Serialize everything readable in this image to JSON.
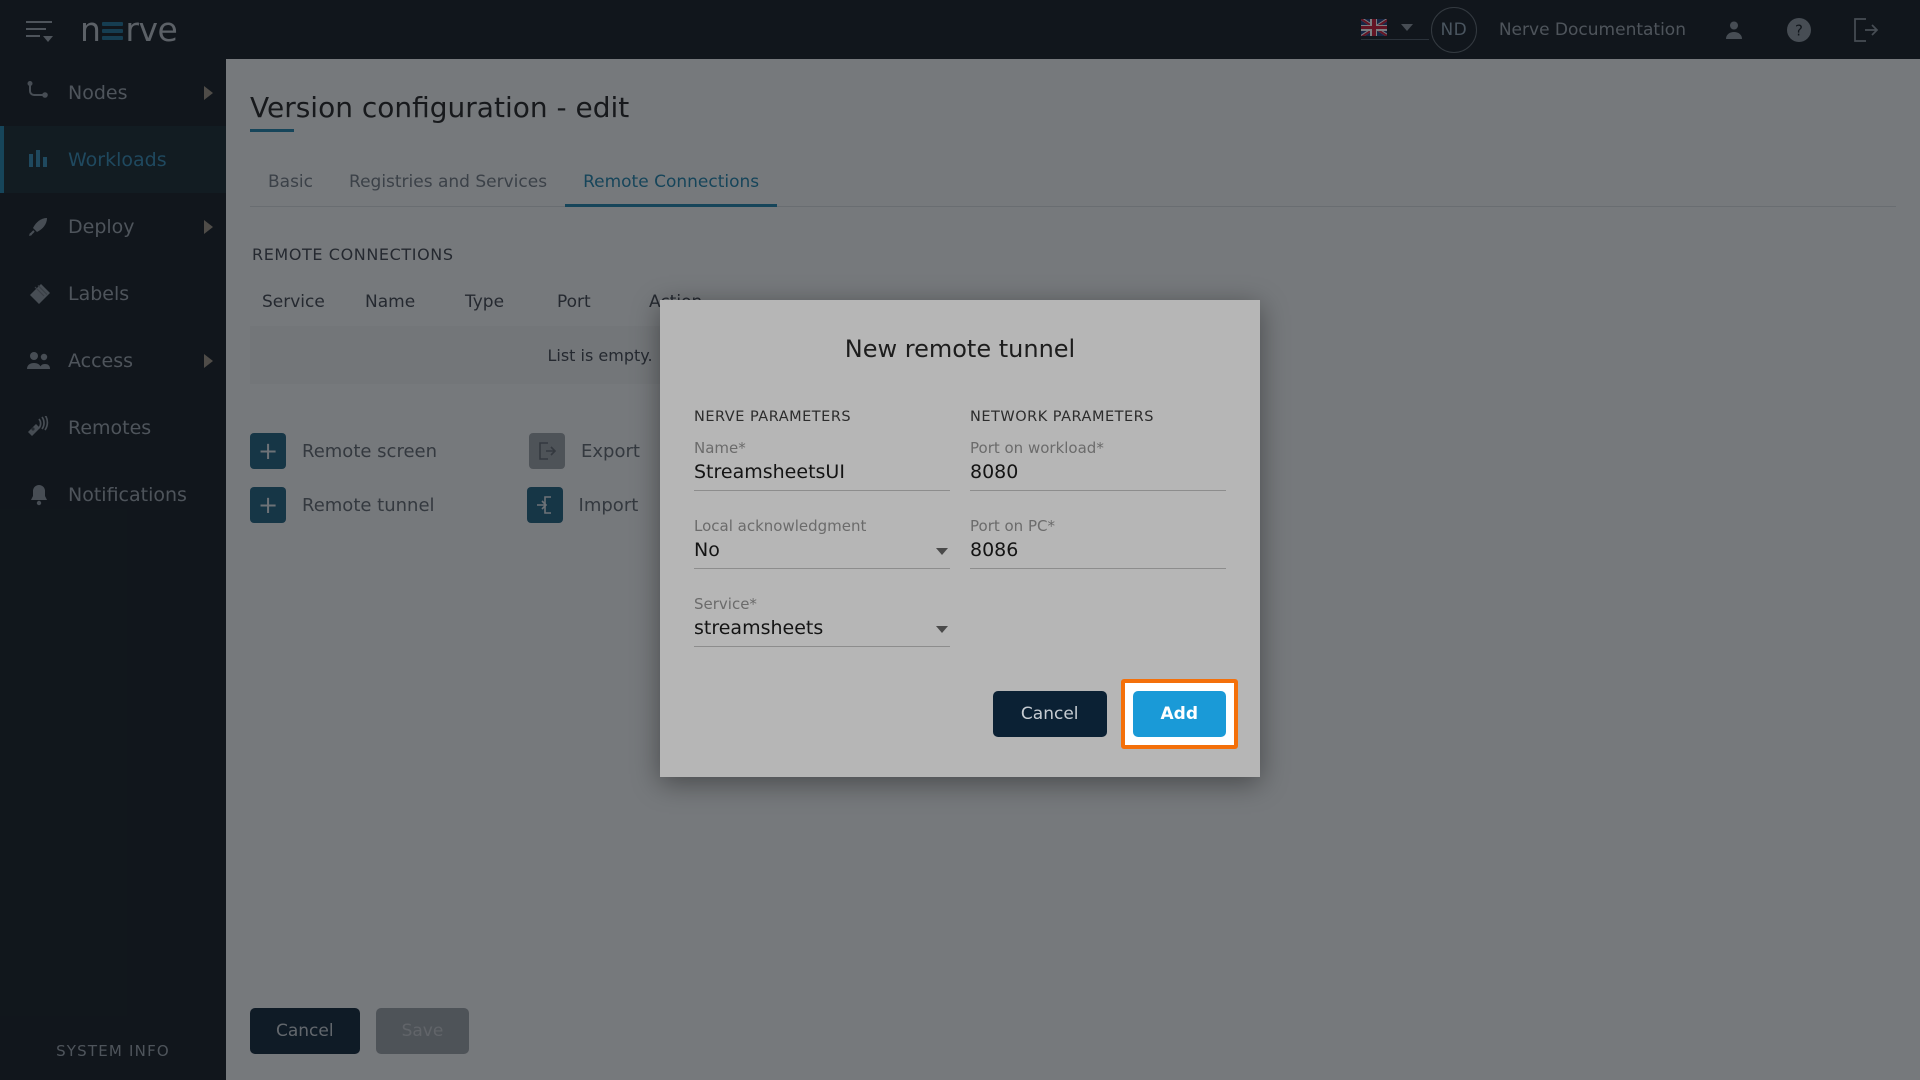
{
  "topbar": {
    "menu_icon": "hamburger-menu-icon",
    "logo_pre": "n",
    "logo_post": "rve",
    "language_flag": "uk-flag-icon",
    "language_caret": "chevron-down-icon",
    "avatar_initials": "ND",
    "username": "Nerve Documentation",
    "user_icon": "person-icon",
    "help_icon": "help-circle-icon",
    "logout_icon": "logout-icon"
  },
  "sidebar": {
    "items": [
      {
        "label": "Nodes",
        "icon": "nodes-icon",
        "active": false,
        "expandable": true
      },
      {
        "label": "Workloads",
        "icon": "workloads-icon",
        "active": true,
        "expandable": false
      },
      {
        "label": "Deploy",
        "icon": "deploy-rocket-icon",
        "active": false,
        "expandable": true
      },
      {
        "label": "Labels",
        "icon": "labels-tag-icon",
        "active": false,
        "expandable": false
      },
      {
        "label": "Access",
        "icon": "access-users-icon",
        "active": false,
        "expandable": true
      },
      {
        "label": "Remotes",
        "icon": "remotes-signal-icon",
        "active": false,
        "expandable": false
      },
      {
        "label": "Notifications",
        "icon": "notifications-bell-icon",
        "active": false,
        "expandable": false
      }
    ],
    "system_info": "SYSTEM INFO"
  },
  "main": {
    "page_title": "Version configuration - edit",
    "tabs": [
      {
        "label": "Basic",
        "active": false
      },
      {
        "label": "Registries and Services",
        "active": false
      },
      {
        "label": "Remote Connections",
        "active": true
      }
    ],
    "section_label": "REMOTE CONNECTIONS",
    "table": {
      "headers": [
        "Service",
        "Name",
        "Type",
        "Port",
        "Action"
      ],
      "empty_message": "List is empty.",
      "rows": []
    },
    "actions": [
      {
        "label": "Remote screen",
        "icon": "plus-icon",
        "disabled": false
      },
      {
        "label": "Export",
        "icon": "export-icon",
        "disabled": true
      },
      {
        "label": "Remote tunnel",
        "icon": "plus-icon",
        "disabled": false
      },
      {
        "label": "Import",
        "icon": "import-icon",
        "disabled": false
      }
    ],
    "footer": {
      "cancel_label": "Cancel",
      "save_label": "Save"
    }
  },
  "modal": {
    "title": "New remote tunnel",
    "left_column": {
      "heading": "NERVE PARAMETERS",
      "fields": [
        {
          "label": "Name*",
          "value": "StreamsheetsUI",
          "type": "text"
        },
        {
          "label": "Local acknowledgment",
          "value": "No",
          "type": "select"
        },
        {
          "label": "Service*",
          "value": "streamsheets",
          "type": "select"
        }
      ]
    },
    "right_column": {
      "heading": "NETWORK PARAMETERS",
      "fields": [
        {
          "label": "Port on workload*",
          "value": "8080",
          "type": "text"
        },
        {
          "label": "Port on PC*",
          "value": "8086",
          "type": "text"
        }
      ]
    },
    "cancel_label": "Cancel",
    "add_label": "Add"
  },
  "colors": {
    "accent_blue": "#1b7fa8",
    "add_button_blue": "#1a9ad7",
    "highlight_orange": "#f4700a",
    "sidebar_bg": "#0e151c",
    "modal_bg": "#b6b6b6"
  }
}
